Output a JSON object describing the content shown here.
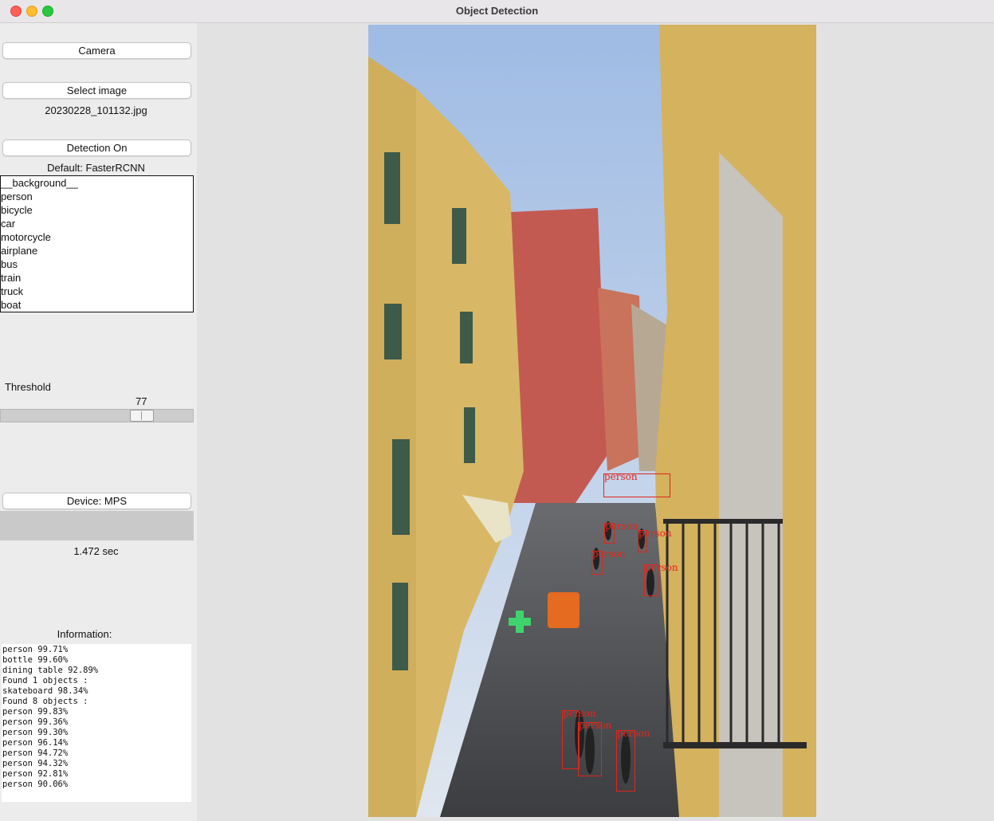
{
  "window": {
    "title": "Object Detection"
  },
  "controls": {
    "camera_button": "Camera",
    "select_image_button": "Select image",
    "file_name": "20230228_101132.jpg",
    "detection_button": "Detection On",
    "model_label": "Default: FasterRCNN",
    "classes": [
      "__background__",
      "person",
      "bicycle",
      "car",
      "motorcycle",
      "airplane",
      "bus",
      "train",
      "truck",
      "boat"
    ],
    "threshold_label": "Threshold",
    "threshold_value": "77",
    "device_button": "Device: MPS",
    "elapsed": "1.472 sec",
    "info_label": "Information:"
  },
  "info_lines": [
    "person 99.71%",
    "bottle 99.60%",
    "dining table 92.89%",
    "Found 1 objects :",
    "skateboard 98.34%",
    "Found 8 objects :",
    "person 99.83%",
    "person 99.36%",
    "person 99.30%",
    "person 96.14%",
    "person 94.72%",
    "person 94.32%",
    "person 92.81%",
    "person 90.06%"
  ],
  "detections": [
    {
      "label": "person"
    },
    {
      "label": "person"
    },
    {
      "label": "person"
    },
    {
      "label": "person"
    },
    {
      "label": "person"
    },
    {
      "label": "person"
    },
    {
      "label": "person"
    },
    {
      "label": "person"
    }
  ],
  "colors": {
    "box": "#e0261c",
    "sky": "#a9c4e6",
    "wall_yellow": "#d9b865",
    "wall_red": "#c25a52",
    "street": "#4c4e52"
  }
}
